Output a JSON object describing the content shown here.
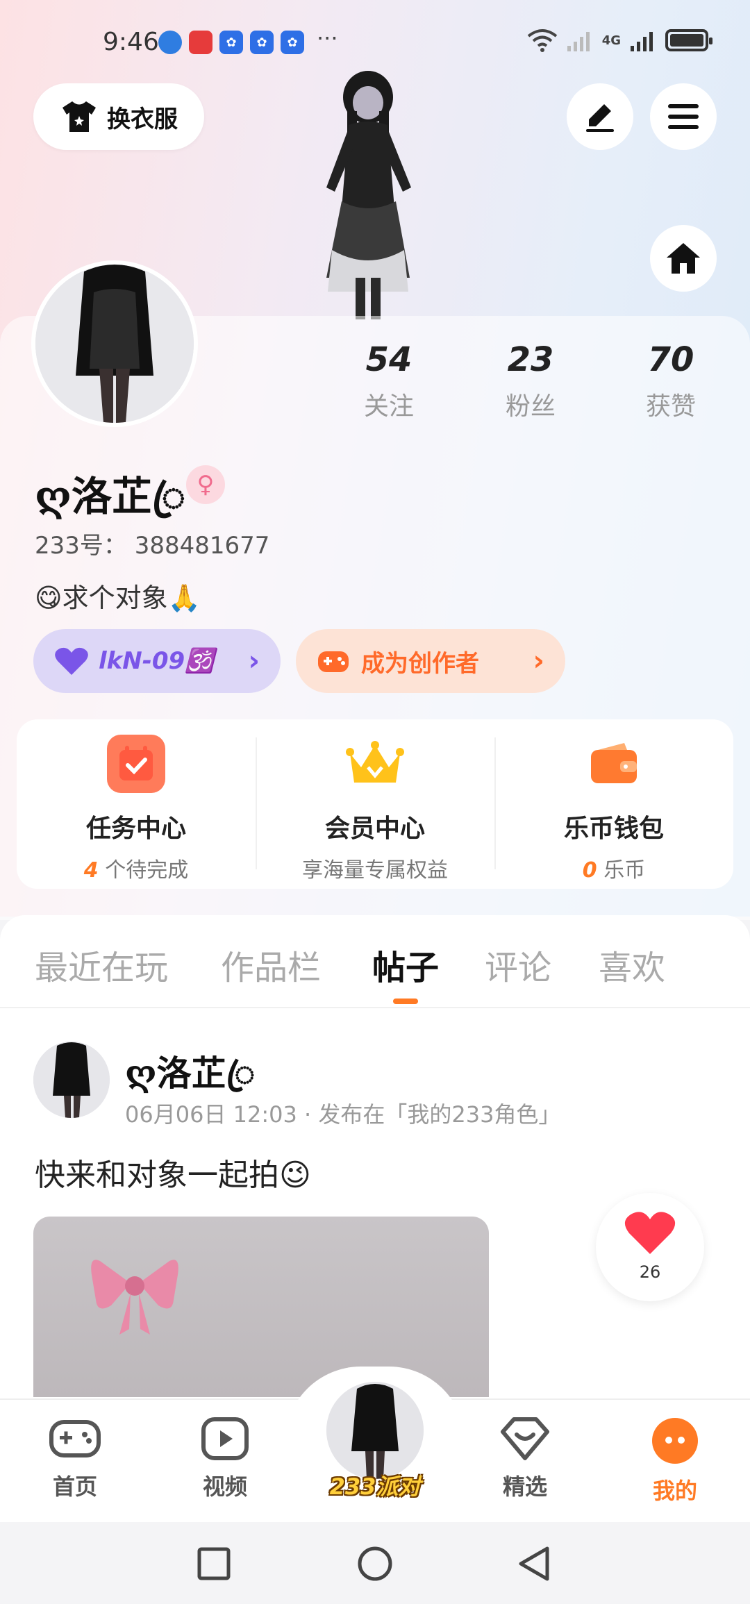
{
  "status": {
    "time": "9:46",
    "network_label": "4G"
  },
  "header": {
    "change_outfit_label": "换衣服"
  },
  "profile": {
    "stats": [
      {
        "value": "54",
        "label": "关注"
      },
      {
        "value": "23",
        "label": "粉丝"
      },
      {
        "value": "70",
        "label": "获赞"
      }
    ],
    "nickname": "ღ洛芷ꦿ",
    "gender_symbol": "♀",
    "uid": "233号： 388481677",
    "bio": "😋求个对象🙏",
    "tag_purple": "lkN-09🕉️",
    "tag_orange": "成为创作者",
    "chevron": "›"
  },
  "quick": [
    {
      "title": "任务中心",
      "accent": "4",
      "sub": " 个待完成"
    },
    {
      "title": "会员中心",
      "accent": "",
      "sub": "享海量专属权益"
    },
    {
      "title": "乐币钱包",
      "accent": "0",
      "sub": " 乐币"
    }
  ],
  "tabs": [
    "最近在玩",
    "作品栏",
    "帖子",
    "评论",
    "喜欢"
  ],
  "post": {
    "author": "ღ洛芷ꦿ",
    "meta": "06月06日 12:03 · 发布在「我的233角色」",
    "text": "快来和对象一起拍😉",
    "likes": "26"
  },
  "bottom_nav": [
    {
      "label": "首页"
    },
    {
      "label": "视频"
    },
    {
      "label": "233派对"
    },
    {
      "label": "精选"
    },
    {
      "label": "我的"
    }
  ],
  "colors": {
    "accent": "#ff7a24",
    "purple": "#7a55e8"
  }
}
